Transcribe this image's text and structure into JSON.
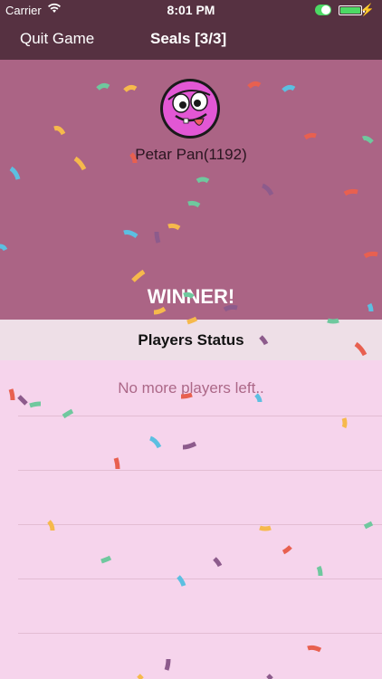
{
  "status_bar": {
    "carrier": "Carrier",
    "time": "8:01 PM"
  },
  "navbar": {
    "quit_label": "Quit Game",
    "title": "Seals [3/3]"
  },
  "winner": {
    "player": "Petar Pan(1192)",
    "banner": "WINNER!",
    "avatar_icon": "pink-monster-avatar"
  },
  "players_status": {
    "header": "Players Status",
    "empty_message": "No more players left.."
  },
  "colors": {
    "navbar": "#563141",
    "hero": "#ab6485",
    "list_bg": "#f6d4ec",
    "header_bg": "#eedfe7",
    "confetti": [
      "#f6b94c",
      "#5cbfe1",
      "#6fc89e",
      "#e86050",
      "#8d5b8c"
    ]
  }
}
